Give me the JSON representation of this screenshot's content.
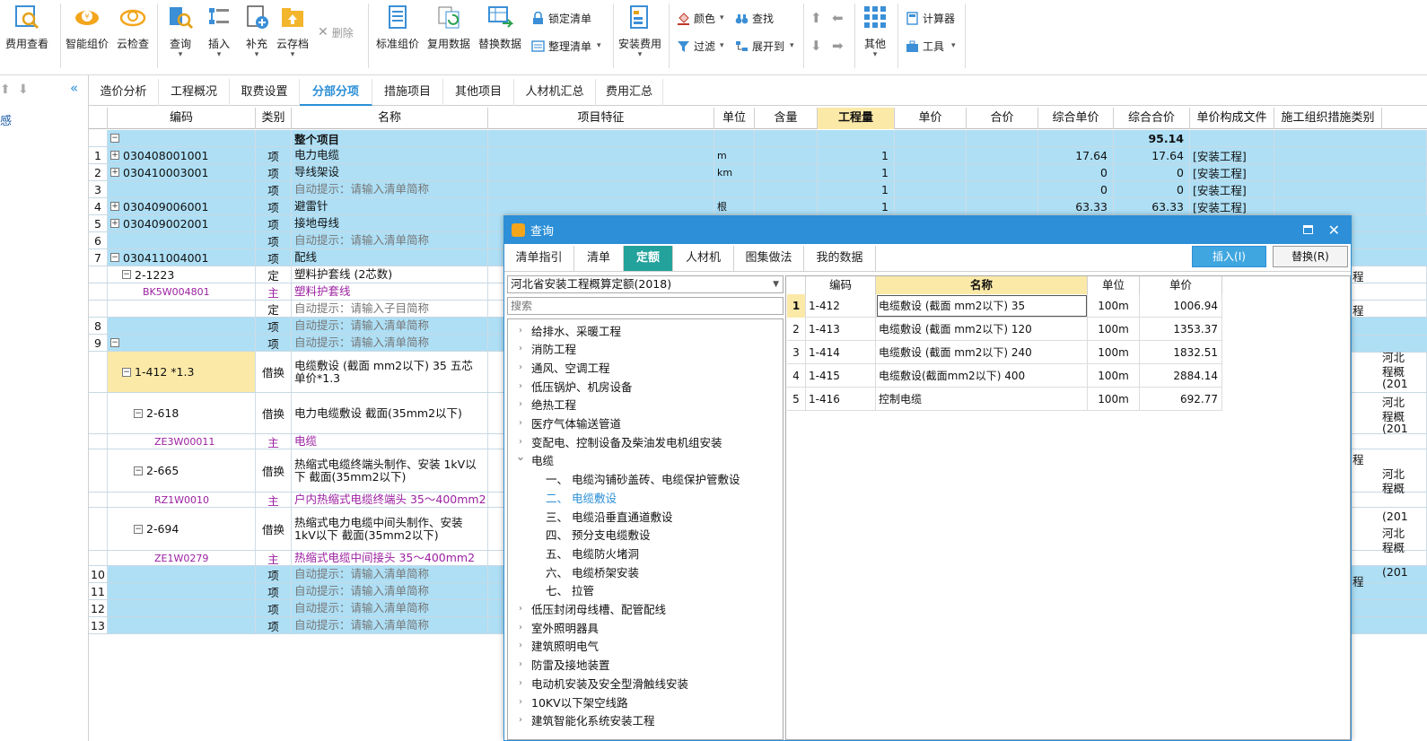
{
  "ribbon": {
    "fee_view": "费用查看",
    "smart_price": "智能组价",
    "cloud_check": "云检查",
    "query": "查询",
    "insert": "插入",
    "supplement": "补充",
    "cloud_archive": "云存档",
    "delete": "删除",
    "std_price": "标准组价",
    "reuse_data": "复用数据",
    "replace_data": "替换数据",
    "lock_list": "锁定清单",
    "tidy_list": "整理清单",
    "install_fee": "安装费用",
    "color": "颜色",
    "find": "查找",
    "filter": "过滤",
    "expand_to": "展开到",
    "other": "其他",
    "calculator": "计算器",
    "tools": "工具"
  },
  "left_panel": {
    "text": "感"
  },
  "tabs": [
    "造价分析",
    "工程概况",
    "取费设置",
    "分部分项",
    "措施项目",
    "其他项目",
    "人材机汇总",
    "费用汇总"
  ],
  "grid": {
    "headers": [
      "编码",
      "类别",
      "名称",
      "项目特征",
      "单位",
      "含量",
      "工程量",
      "单价",
      "合价",
      "综合单价",
      "综合合价",
      "单价构成文件",
      "施工组织措施类别"
    ],
    "top_row": {
      "name": "整个项目",
      "total": "95.14"
    },
    "rows": [
      {
        "n": "1",
        "code": "030408001001",
        "type": "项",
        "name": "电力电缆",
        "unit": "m",
        "qty": "1",
        "uprice": "17.64",
        "total": "17.64",
        "file": "[安装工程]"
      },
      {
        "n": "2",
        "code": "030410003001",
        "type": "项",
        "name": "导线架设",
        "unit": "km",
        "qty": "1",
        "uprice": "0",
        "total": "0",
        "file": "[安装工程]"
      },
      {
        "n": "3",
        "code": "",
        "type": "项",
        "name": "自动提示：请输入清单简称",
        "unit": "",
        "qty": "1",
        "uprice": "0",
        "total": "0",
        "file": "[安装工程]"
      },
      {
        "n": "4",
        "code": "030409006001",
        "type": "项",
        "name": "避雷针",
        "unit": "根",
        "qty": "1",
        "uprice": "63.33",
        "total": "63.33",
        "file": "[安装工程]"
      },
      {
        "n": "5",
        "code": "030409002001",
        "type": "项",
        "name": "接地母线"
      },
      {
        "n": "6",
        "code": "",
        "type": "项",
        "name": "自动提示：请输入清单简称"
      },
      {
        "n": "7",
        "code": "030411004001",
        "type": "项",
        "name": "配线"
      },
      {
        "n": "",
        "code": "2-1223",
        "type": "定",
        "name": "塑料护套线 (2芯数)"
      },
      {
        "n": "",
        "code": "BK5W004801",
        "type": "主",
        "name": "塑料护套线"
      },
      {
        "n": "",
        "code": "",
        "type": "定",
        "name": "自动提示：请输入子目简称"
      },
      {
        "n": "8",
        "code": "",
        "type": "项",
        "name": "自动提示：请输入清单简称"
      },
      {
        "n": "9",
        "code": "",
        "type": "项",
        "name": "自动提示：请输入清单简称"
      },
      {
        "n": "",
        "code": "1-412 *1.3",
        "type": "借换",
        "name": "电缆敷设 (截面 mm2以下) 35 五芯 单价*1.3"
      },
      {
        "n": "",
        "code": "2-618",
        "type": "借换",
        "name": "电力电缆敷设 截面(35mm2以下)"
      },
      {
        "n": "",
        "code": "ZE3W00011",
        "type": "主",
        "name": "电缆"
      },
      {
        "n": "",
        "code": "2-665",
        "type": "借换",
        "name": "热缩式电缆终端头制作、安装 1kV以下 截面(35mm2以下)"
      },
      {
        "n": "",
        "code": "RZ1W0010",
        "type": "主",
        "name": "户内热缩式电缆终端头 35～400mm2"
      },
      {
        "n": "",
        "code": "2-694",
        "type": "借换",
        "name": "热缩式电力电缆中间头制作、安装 1kV以下 截面(35mm2以下)"
      },
      {
        "n": "",
        "code": "ZE1W0279",
        "type": "主",
        "name": "热缩式电缆中间接头 35～400mm2"
      },
      {
        "n": "10",
        "code": "",
        "type": "项",
        "name": "自动提示：请输入清单简称"
      },
      {
        "n": "11",
        "code": "",
        "type": "项",
        "name": "自动提示：请输入清单简称"
      },
      {
        "n": "12",
        "code": "",
        "type": "项",
        "name": "自动提示：请输入清单简称"
      },
      {
        "n": "13",
        "code": "",
        "type": "项",
        "name": "自动提示：请输入清单简称"
      }
    ],
    "right_fragments": [
      "程",
      "程",
      "河北",
      "程概",
      "(201",
      "河北",
      "程概",
      "(201",
      "程",
      "河北",
      "程概",
      "(201",
      "河北",
      "程概",
      "(201",
      "程"
    ]
  },
  "dialog": {
    "title": "查询",
    "tabs": [
      "清单指引",
      "清单",
      "定额",
      "人材机",
      "图集做法",
      "我的数据"
    ],
    "insert_btn": "插入(I)",
    "replace_btn": "替换(R)",
    "library": "河北省安装工程概算定额(2018)",
    "search_placeholder": "搜索",
    "tree": [
      {
        "label": "给排水、采暖工程",
        "level": 0,
        "exp": false
      },
      {
        "label": "消防工程",
        "level": 0,
        "exp": false
      },
      {
        "label": "通风、空调工程",
        "level": 0,
        "exp": false
      },
      {
        "label": "低压锅炉、机房设备",
        "level": 0,
        "exp": false
      },
      {
        "label": "绝热工程",
        "level": 0,
        "exp": false
      },
      {
        "label": "医疗气体输送管道",
        "level": 0,
        "exp": false
      },
      {
        "label": "变配电、控制设备及柴油发电机组安装",
        "level": 0,
        "exp": false
      },
      {
        "label": "电缆",
        "level": 0,
        "exp": true
      },
      {
        "label": "一、 电缆沟铺砂盖砖、电缆保护管敷设",
        "level": 1
      },
      {
        "label": "二、 电缆敷设",
        "level": 1,
        "sel": true
      },
      {
        "label": "三、 电缆沿垂直通道敷设",
        "level": 1
      },
      {
        "label": "四、 预分支电缆敷设",
        "level": 1
      },
      {
        "label": "五、 电缆防火堵洞",
        "level": 1
      },
      {
        "label": "六、 电缆桥架安装",
        "level": 1
      },
      {
        "label": "七、 拉管",
        "level": 1
      },
      {
        "label": "低压封闭母线槽、配管配线",
        "level": 0,
        "exp": false
      },
      {
        "label": "室外照明器具",
        "level": 0,
        "exp": false
      },
      {
        "label": "建筑照明电气",
        "level": 0,
        "exp": false
      },
      {
        "label": "防雷及接地装置",
        "level": 0,
        "exp": false
      },
      {
        "label": "电动机安装及安全型滑触线安装",
        "level": 0,
        "exp": false
      },
      {
        "label": "10KV以下架空线路",
        "level": 0,
        "exp": false
      },
      {
        "label": "建筑智能化系统安装工程",
        "level": 0,
        "exp": false
      }
    ],
    "result_headers": [
      "编码",
      "名称",
      "单位",
      "单价"
    ],
    "results": [
      {
        "n": "1",
        "code": "1-412",
        "name": "电缆敷设 (截面 mm2以下) 35",
        "unit": "100m",
        "price": "1006.94"
      },
      {
        "n": "2",
        "code": "1-413",
        "name": "电缆敷设 (截面 mm2以下) 120",
        "unit": "100m",
        "price": "1353.37"
      },
      {
        "n": "3",
        "code": "1-414",
        "name": "电缆敷设 (截面 mm2以下) 240",
        "unit": "100m",
        "price": "1832.51"
      },
      {
        "n": "4",
        "code": "1-415",
        "name": "电缆敷设(截面mm2以下) 400",
        "unit": "100m",
        "price": "2884.14"
      },
      {
        "n": "5",
        "code": "1-416",
        "name": "控制电缆",
        "unit": "100m",
        "price": "692.77"
      }
    ]
  },
  "colors": {
    "accent": "#2c8fd7",
    "row_blue": "#aedff5",
    "tab_green": "#23a29c",
    "purple": "#9b1fa0"
  }
}
